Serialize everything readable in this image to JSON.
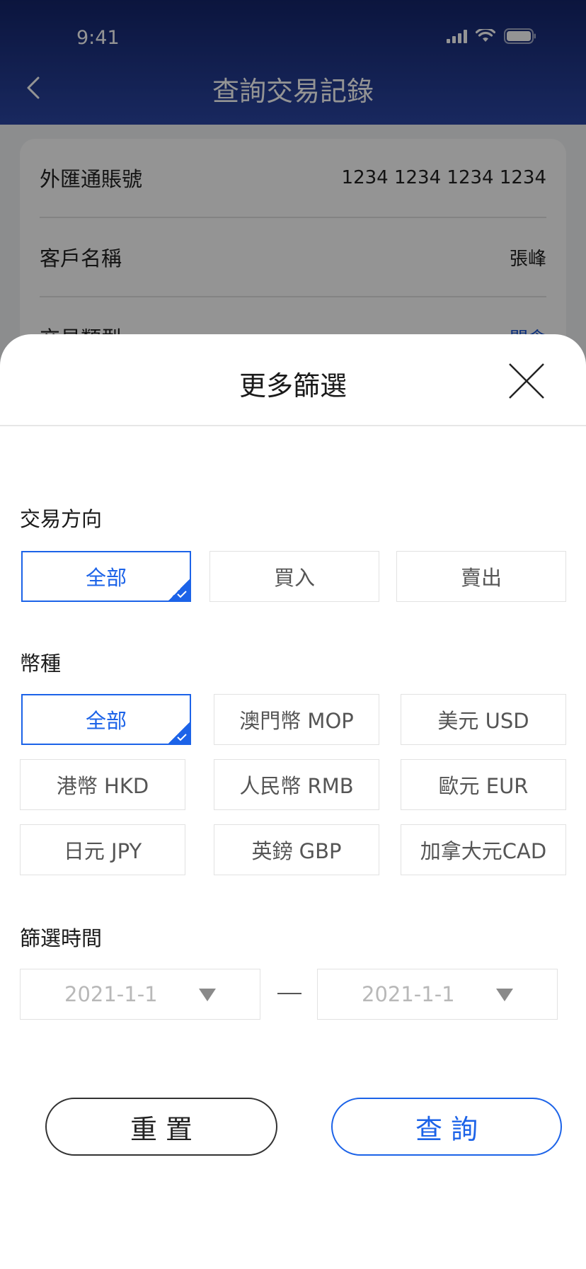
{
  "status_bar": {
    "time": "9:41"
  },
  "header": {
    "title": "查詢交易記錄"
  },
  "info_card": {
    "rows": [
      {
        "label": "外匯通賬號",
        "value": "1234 1234 1234 1234"
      },
      {
        "label": "客戶名稱",
        "value": "張峰"
      },
      {
        "label": "交易類型",
        "value": "開倉"
      }
    ]
  },
  "sheet": {
    "title": "更多篩選",
    "direction": {
      "label": "交易方向",
      "options": [
        "全部",
        "買入",
        "賣出"
      ],
      "selected": "全部"
    },
    "currency": {
      "label": "幣種",
      "options": [
        "全部",
        "澳門幣 MOP",
        "美元 USD",
        "港幣 HKD",
        "人民幣 RMB",
        "歐元 EUR",
        "日元 JPY",
        "英鎊 GBP",
        "加拿大元CAD"
      ],
      "selected": "全部"
    },
    "time": {
      "label": "篩選時間",
      "start": "2021-1-1",
      "end": "2021-1-1"
    },
    "buttons": {
      "reset": "重置",
      "query": "查詢"
    }
  },
  "colors": {
    "accent": "#1c63e8",
    "header": "#2b46a4"
  }
}
